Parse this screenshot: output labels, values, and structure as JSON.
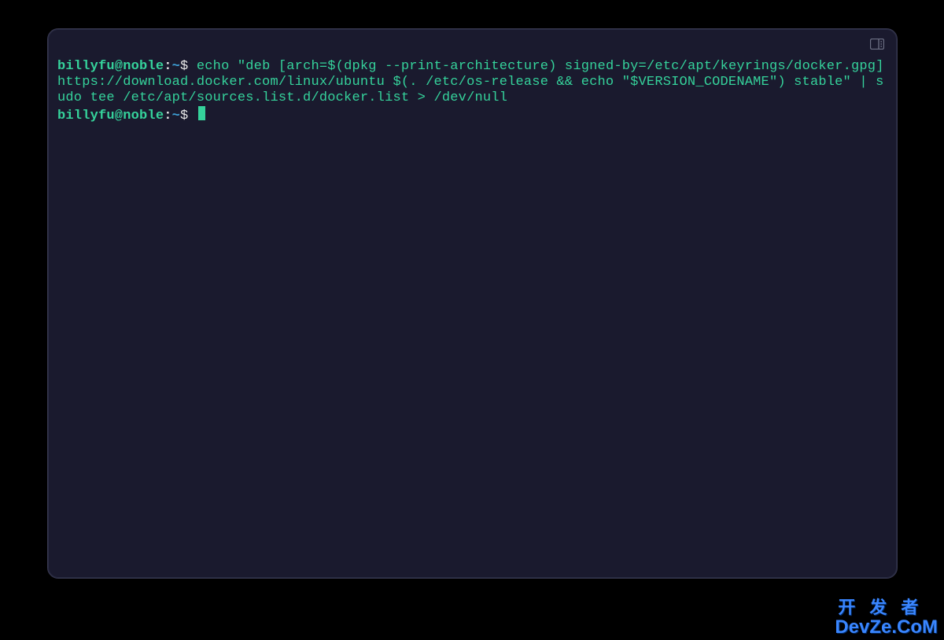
{
  "terminal": {
    "prompt": {
      "user_host": "billyfu@noble",
      "separator": ":",
      "path": "~",
      "symbol": "$"
    },
    "lines": [
      {
        "type": "command",
        "text": "echo \"deb [arch=$(dpkg --print-architecture) signed-by=/etc/apt/keyrings/docker.gpg] https://download.docker.com/linux/ubuntu $(. /etc/os-release && echo \"$VERSION_CODENAME\") stable\" | sudo tee /etc/apt/sources.list.d/docker.list > /dev/null"
      },
      {
        "type": "prompt_only"
      }
    ]
  },
  "watermark": {
    "line1": "开发者",
    "line2": "DevZe.CoM"
  },
  "colors": {
    "bg_outer": "#000000",
    "bg_terminal": "#1a1a2e",
    "prompt_green": "#35d29b",
    "prompt_blue": "#3ea0d6",
    "text": "#e8e8e8",
    "watermark_blue": "#3a86ff"
  }
}
